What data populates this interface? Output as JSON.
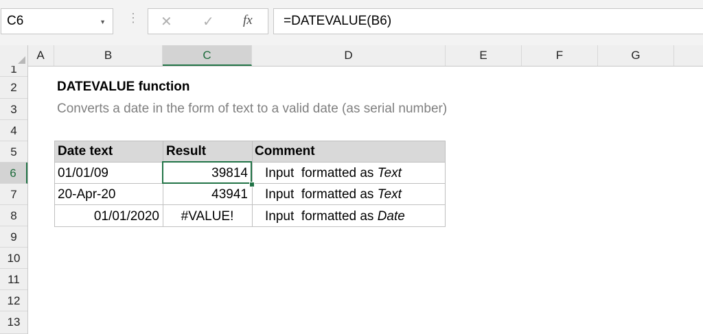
{
  "formula_bar": {
    "name_box": "C6",
    "formula": "=DATEVALUE(B6)"
  },
  "columns": [
    "A",
    "B",
    "C",
    "D",
    "E",
    "F",
    "G"
  ],
  "rows": [
    "1",
    "2",
    "3",
    "4",
    "5",
    "6",
    "7",
    "8",
    "9",
    "10",
    "11",
    "12",
    "13"
  ],
  "sheet": {
    "title": "DATEVALUE function",
    "subtitle": "Converts a date in the form of text to  a valid date (as serial number)",
    "table": {
      "headers": [
        "Date text",
        "Result",
        "Comment"
      ],
      "rows": [
        {
          "date_text": "01/01/09",
          "result": "39814",
          "comment_prefix": "Input  formatted as ",
          "comment_type": "Text"
        },
        {
          "date_text": "20-Apr-20",
          "result": "43941",
          "comment_prefix": "Input  formatted as ",
          "comment_type": "Text"
        },
        {
          "date_text": "01/01/2020",
          "result": "#VALUE!",
          "comment_prefix": "Input  formatted as ",
          "comment_type": "Date"
        }
      ]
    }
  },
  "selected_cell": "C6",
  "colors": {
    "accent": "#217346",
    "header_fill": "#d9d9d9",
    "subtitle": "#7f7f7f"
  }
}
